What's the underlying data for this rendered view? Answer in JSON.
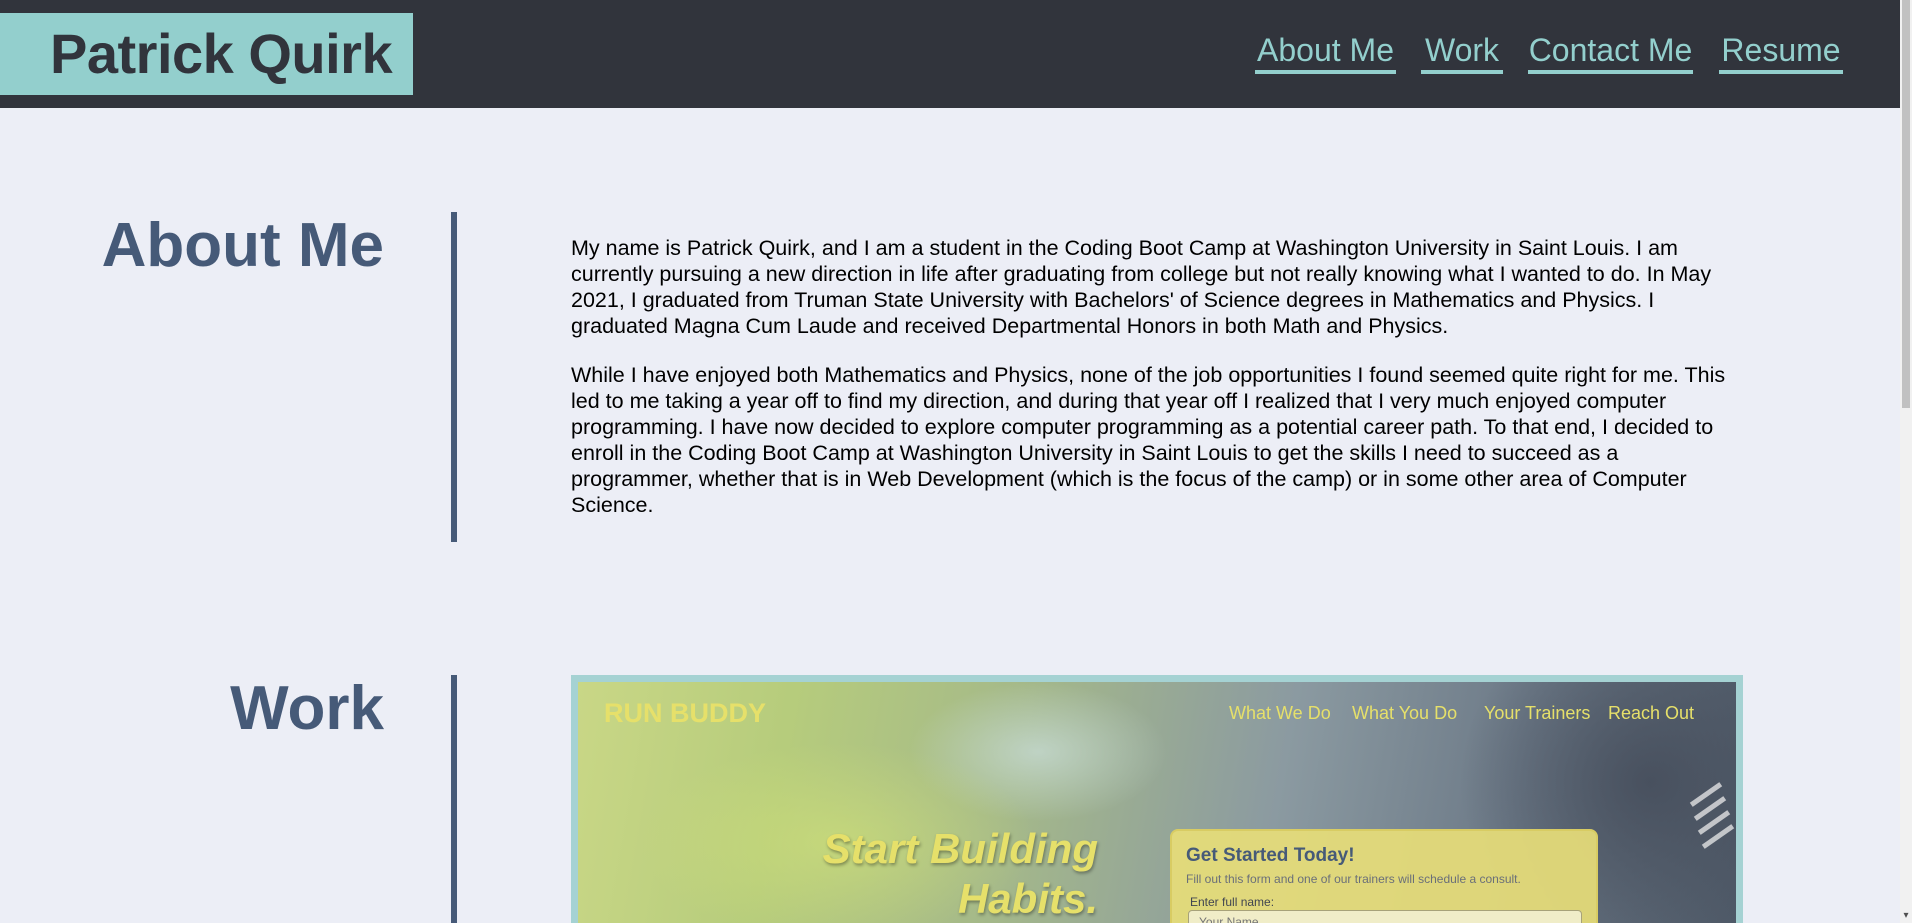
{
  "header": {
    "brand": "Patrick Quirk",
    "nav": [
      {
        "label": "About Me"
      },
      {
        "label": "Work"
      },
      {
        "label": "Contact Me"
      },
      {
        "label": "Resume"
      }
    ]
  },
  "about": {
    "title": "About Me",
    "paragraphs": [
      "My name is Patrick Quirk, and I am a student in the Coding Boot Camp at Washington University in Saint Louis. I am currently pursuing a new direction in life after graduating from college but not really knowing what I wanted to do. In May 2021, I graduated from Truman State University with Bachelors' of Science degrees in Mathematics and Physics. I graduated Magna Cum Laude and received Departmental Honors in both Math and Physics.",
      "While I have enjoyed both Mathematics and Physics, none of the job opportunities I found seemed quite right for me. This led to me taking a year off to find my direction, and during that year off I realized that I very much enjoyed computer programming. I have now decided to explore computer programming as a potential career path. To that end, I decided to enroll in the Coding Boot Camp at Washington University in Saint Louis to get the skills I need to succeed as a programmer, whether that is in Web Development (which is the focus of the camp) or in some other area of Computer Science."
    ]
  },
  "work": {
    "title": "Work",
    "project": {
      "logo": "RUN BUDDY",
      "nav": [
        "What We Do",
        "What You Do",
        "Your Trainers",
        "Reach Out"
      ],
      "hero_line1": "Start Building",
      "hero_line2": "Habits.",
      "form_title": "Get Started Today!",
      "form_subtitle": "Fill out this form and one of our trainers will schedule a consult.",
      "form_label": "Enter full name:",
      "form_placeholder": "Your Name"
    }
  },
  "colors": {
    "header_bg": "#31343c",
    "accent": "#93cfcd",
    "heading": "#465a78",
    "page_bg": "#eceef6",
    "project_accent": "#e6e06a"
  },
  "icons": {
    "scroll_down": "chevron-down-icon"
  }
}
